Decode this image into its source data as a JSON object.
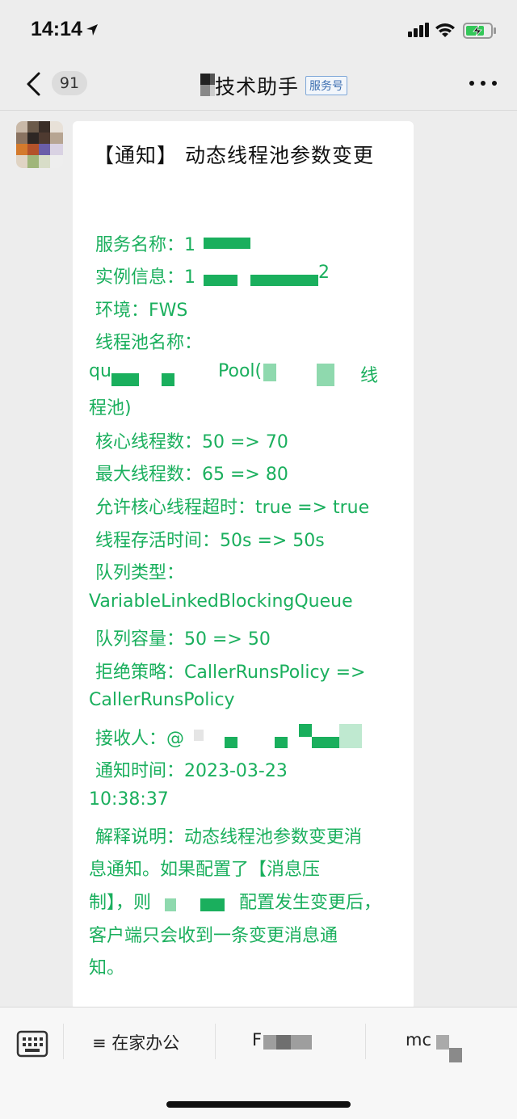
{
  "status_bar": {
    "time": "14:14"
  },
  "nav": {
    "unread_count": "91",
    "title": "技术助手",
    "service_tag": "服务号"
  },
  "message": {
    "title": "【通知】 动态线程池参数变更",
    "lines": {
      "l1": "服务名称：1",
      "l2": "实例信息：1",
      "l2b": "2",
      "l3": "环境：FWS",
      "l4": "线程池名称：",
      "l5a": "qu",
      "l5b": "Pool(",
      "l5c": "线",
      "l6": "程池)",
      "l7": "核心线程数：50 => 70",
      "l8": "最大线程数：65 => 80",
      "l9": "允许核心线程超时：true => true",
      "l10": "线程存活时间：50s => 50s",
      "l11": "队列类型：",
      "l12": "VariableLinkedBlockingQueue",
      "l13": "队列容量：50 => 50",
      "l14": "拒绝策略：CallerRunsPolicy =>",
      "l15": "CallerRunsPolicy",
      "l16": "接收人：@",
      "l17": "通知时间：2023-03-23",
      "l18": "10:38:37",
      "l19": "解释说明：动态线程池参数变更消",
      "l20": "息通知。如果配置了【消息压",
      "l21a": "制】，则",
      "l21b": "配置发生变更后，",
      "l22": "客户端只会收到一条变更消息通",
      "l23": "知。"
    }
  },
  "bottom_menu": {
    "item1": "≡ 在家办公",
    "item2": "F",
    "item3": "mc"
  },
  "colors": {
    "message_text": "#1aaf5d",
    "background": "#ededed"
  }
}
